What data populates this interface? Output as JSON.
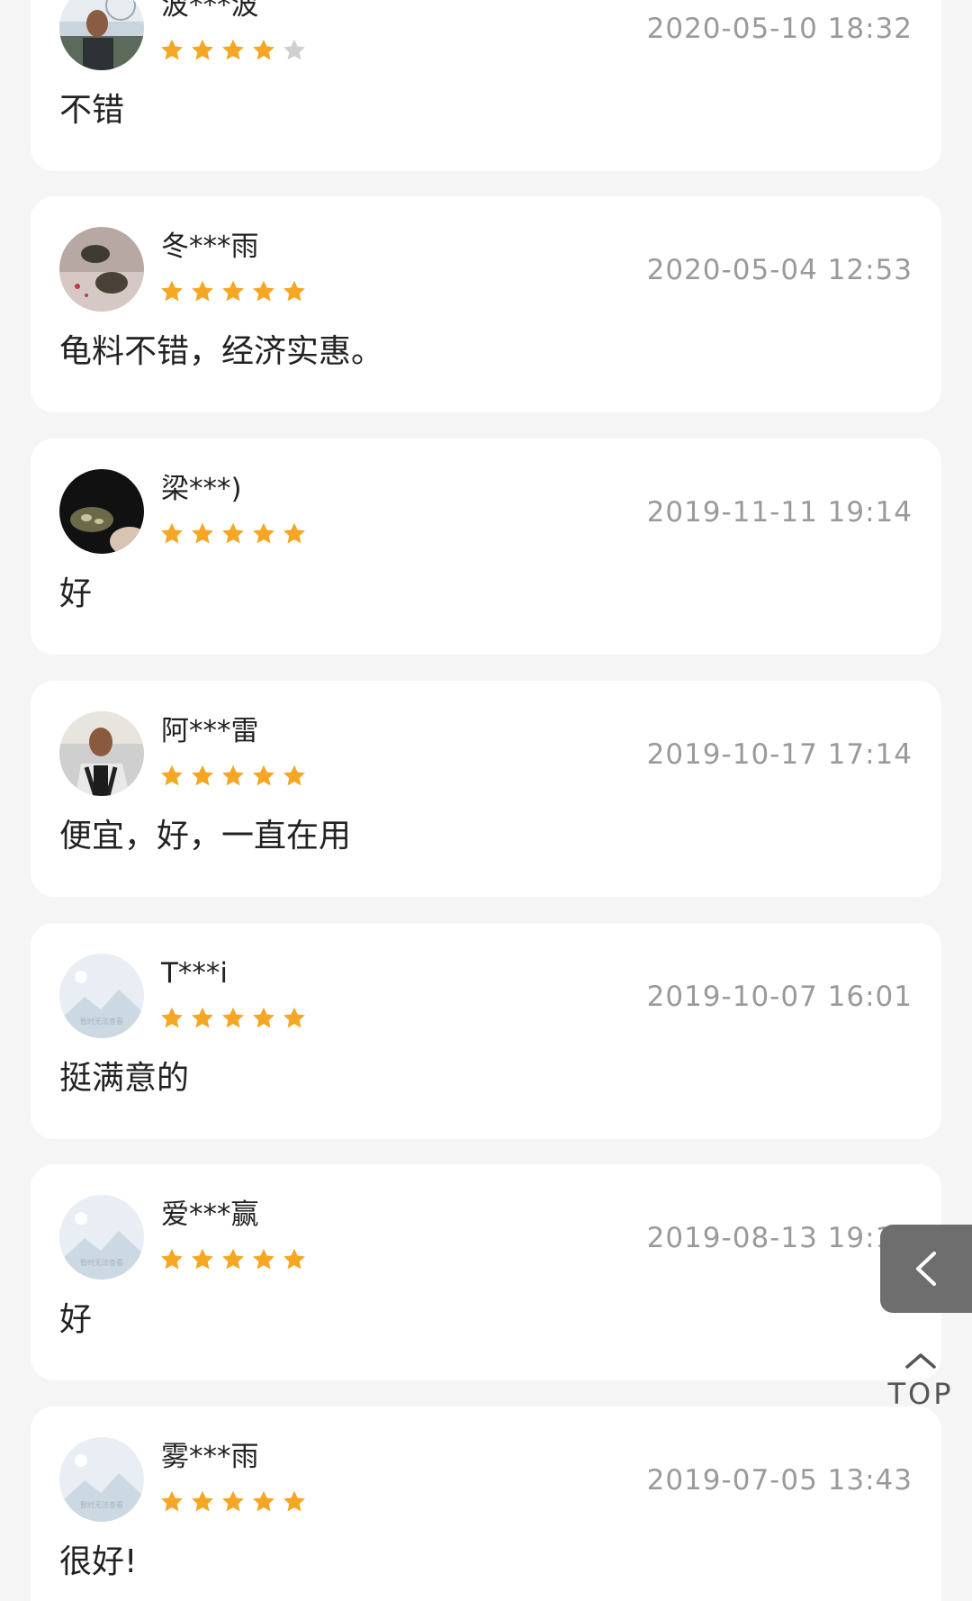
{
  "reviews": [
    {
      "username": "波***波",
      "timestamp": "2020-05-10 18:32",
      "rating": 4,
      "comment": "不错",
      "avatar": "photo-man-outdoor"
    },
    {
      "username": "冬***雨",
      "timestamp": "2020-05-04 12:53",
      "rating": 5,
      "comment": "龟料不错，经济实惠。",
      "avatar": "photo-turtles"
    },
    {
      "username": "梁***)",
      "timestamp": "2019-11-11 19:14",
      "rating": 5,
      "comment": "好",
      "avatar": "photo-turtle-hand"
    },
    {
      "username": "阿***雷",
      "timestamp": "2019-10-17 17:14",
      "rating": 5,
      "comment": "便宜，好，一直在用",
      "avatar": "photo-man-shirt"
    },
    {
      "username": "T***i",
      "timestamp": "2019-10-07 16:01",
      "rating": 5,
      "comment": "挺满意的",
      "avatar": "placeholder-image"
    },
    {
      "username": "爱***赢",
      "timestamp": "2019-08-13 19:17",
      "rating": 5,
      "comment": "好",
      "avatar": "placeholder-image"
    },
    {
      "username": "雾***雨",
      "timestamp": "2019-07-05 13:43",
      "rating": 5,
      "comment": "很好!",
      "avatar": "placeholder-image"
    }
  ],
  "avatar_placeholder_text": "暂时无法查看",
  "controls": {
    "back_icon": "chevron-left-icon",
    "top_label": "TOP",
    "top_icon": "chevron-up-icon"
  },
  "colors": {
    "background": "#f5f5f5",
    "card": "#ffffff",
    "star_filled": "#f5a623",
    "star_empty": "#d0d0d0",
    "timestamp": "#9a9a9a",
    "back_button": "#6e6e6e"
  }
}
